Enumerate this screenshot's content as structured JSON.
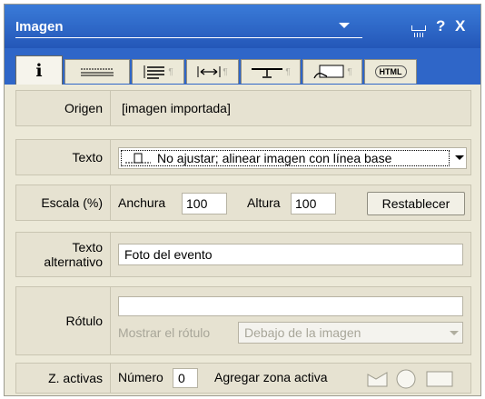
{
  "window": {
    "title": "Imagen",
    "help": "?",
    "close": "X"
  },
  "tabs": [
    {
      "icon": "info-icon",
      "glyph": "i"
    },
    {
      "icon": "rule-icon"
    },
    {
      "icon": "align-text-icon"
    },
    {
      "icon": "horizontal-arrows-icon",
      "glyph": "↔"
    },
    {
      "icon": "baseline-icon"
    },
    {
      "icon": "image-link-icon"
    },
    {
      "icon": "html-icon",
      "glyph": "HTML"
    }
  ],
  "origen": {
    "label": "Origen",
    "value": "[imagen importada]"
  },
  "texto": {
    "label": "Texto",
    "selected": "No ajustar; alinear imagen con línea base"
  },
  "escala": {
    "label": "Escala (%)",
    "anchura_label": "Anchura",
    "anchura_value": "100",
    "altura_label": "Altura",
    "altura_value": "100",
    "reset_button": "Restablecer"
  },
  "alt": {
    "label_line1": "Texto",
    "label_line2": "alternativo",
    "value": "Foto del evento"
  },
  "rotulo": {
    "label": "Rótulo",
    "value": "",
    "show_label": "Mostrar el rótulo",
    "position_selected": "Debajo de la imagen"
  },
  "zonas": {
    "label": "Z. activas",
    "numero_label": "Número",
    "numero_value": "0",
    "add_label": "Agregar zona activa"
  }
}
